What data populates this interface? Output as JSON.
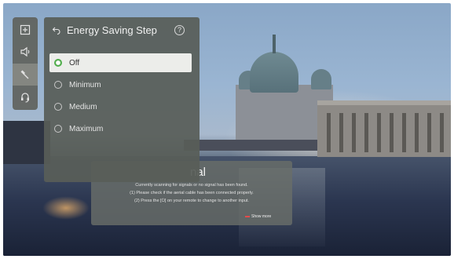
{
  "sidebar": {
    "items": [
      {
        "icon": "picture-icon",
        "active": false
      },
      {
        "icon": "speaker-icon",
        "active": false
      },
      {
        "icon": "wrench-icon",
        "active": true
      },
      {
        "icon": "headset-icon",
        "active": false
      }
    ]
  },
  "panel": {
    "title": "Energy Saving Step",
    "back_icon": "back-arrow-icon",
    "help_icon": "help-icon",
    "help_glyph": "?",
    "options": [
      {
        "label": "Off",
        "selected": true
      },
      {
        "label": "Minimum",
        "selected": false
      },
      {
        "label": "Medium",
        "selected": false
      },
      {
        "label": "Maximum",
        "selected": false
      }
    ]
  },
  "dialog": {
    "title_partial": "nal",
    "lines": [
      "Currently scanning for signals or no signal has been found.",
      "(1) Please check if the aerial cable has been connected properly.",
      "(2) Press the [⏻] on your remote to change to another input."
    ],
    "link": "Show more"
  },
  "colors": {
    "accent_green": "#4fae4a",
    "link_red": "#e34b4b"
  }
}
